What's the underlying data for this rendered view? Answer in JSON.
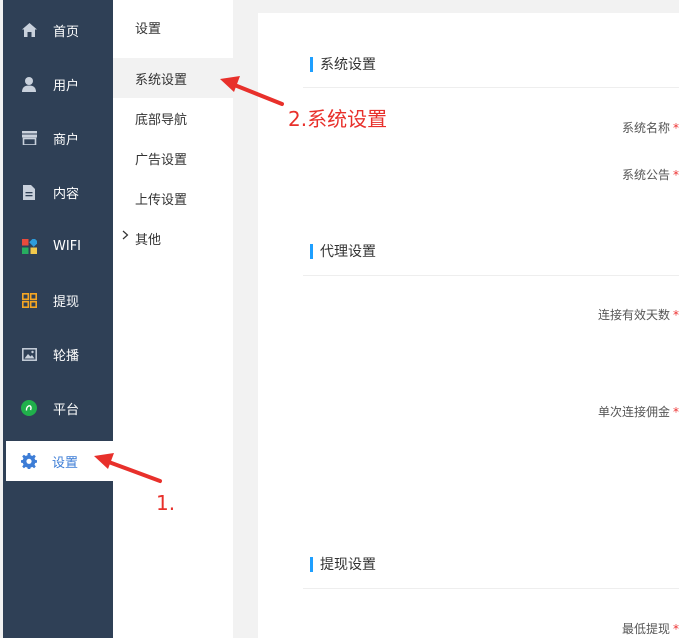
{
  "sidebar": {
    "items": [
      {
        "label": "首页",
        "icon": "home-icon"
      },
      {
        "label": "用户",
        "icon": "user-icon"
      },
      {
        "label": "商户",
        "icon": "store-icon"
      },
      {
        "label": "内容",
        "icon": "document-icon"
      },
      {
        "label": "WIFI",
        "icon": "grid-colored-icon"
      },
      {
        "label": "提现",
        "icon": "withdraw-grid-icon"
      },
      {
        "label": "轮播",
        "icon": "image-icon"
      },
      {
        "label": "平台",
        "icon": "platform-circle-icon"
      },
      {
        "label": "设置",
        "icon": "gear-icon"
      }
    ],
    "active_index": 8
  },
  "submenu": {
    "title": "设置",
    "items": [
      {
        "label": "系统设置"
      },
      {
        "label": "底部导航"
      },
      {
        "label": "广告设置"
      },
      {
        "label": "上传设置"
      },
      {
        "label": "其他"
      }
    ],
    "active_index": 0,
    "expand_icon": "chevron-right-icon"
  },
  "content": {
    "sections": [
      {
        "title": "系统设置",
        "fields": [
          "系统名称",
          "系统公告"
        ]
      },
      {
        "title": "代理设置",
        "fields": [
          "连接有效天数",
          "单次连接佣金"
        ]
      },
      {
        "title": "提现设置",
        "fields": [
          "最低提现"
        ]
      }
    ],
    "required_mark": "*"
  },
  "annotations": {
    "step1": "1.",
    "step2": "2.系统设置"
  },
  "colors": {
    "sidebar_bg": "#2f4056",
    "accent": "#1e9fff",
    "active_text": "#3d7dd6",
    "annotation": "#e8302b"
  }
}
